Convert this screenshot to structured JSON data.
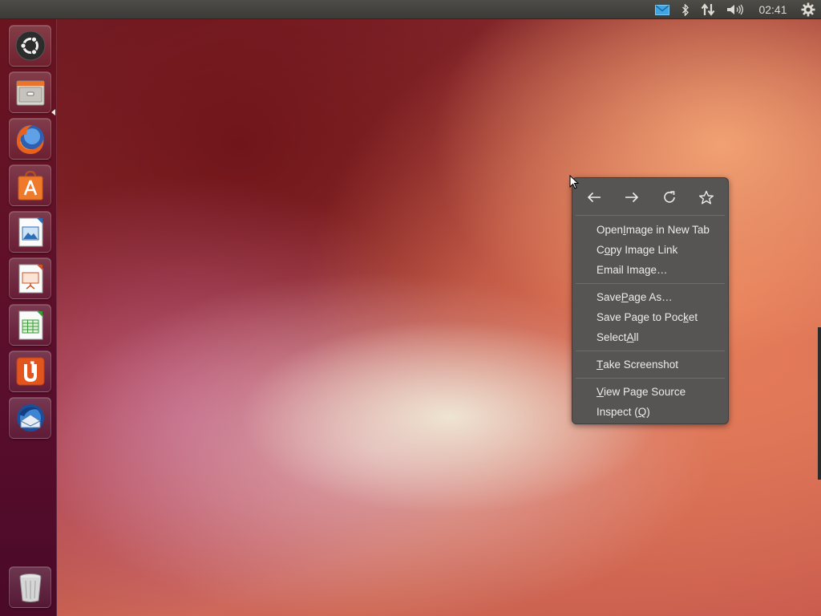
{
  "top_panel": {
    "clock": "02:41",
    "indicators": [
      "mail-icon",
      "bluetooth-icon",
      "network-icon",
      "volume-icon",
      "gear-icon"
    ],
    "mail_color": "#3ea6e6"
  },
  "launcher": {
    "items": [
      {
        "name": "ubuntu-dash",
        "icon": "ubuntu-logo-icon"
      },
      {
        "name": "files",
        "icon": "file-cabinet-icon"
      },
      {
        "name": "firefox",
        "icon": "firefox-icon"
      },
      {
        "name": "software-center",
        "icon": "shopping-bag-icon"
      },
      {
        "name": "libreoffice-draw",
        "icon": "document-draw-icon"
      },
      {
        "name": "libreoffice-impress",
        "icon": "presentation-icon"
      },
      {
        "name": "libreoffice-calc",
        "icon": "spreadsheet-icon"
      },
      {
        "name": "ubuntu-one",
        "icon": "ubuntu-one-icon"
      },
      {
        "name": "thunderbird",
        "icon": "thunderbird-icon"
      },
      {
        "name": "trash",
        "icon": "trash-icon"
      }
    ]
  },
  "context_menu": {
    "nav_icons": [
      "back-arrow-icon",
      "forward-arrow-icon",
      "reload-icon",
      "bookmark-star-icon"
    ],
    "items": [
      {
        "pre": "Open ",
        "mn": "I",
        "post": "mage in New Tab"
      },
      {
        "pre": "C",
        "mn": "o",
        "post": "py Image Link"
      },
      {
        "pre": "Email Ima",
        "mn": "g",
        "post": "e…"
      },
      {
        "pre": "Save ",
        "mn": "P",
        "post": "age As…"
      },
      {
        "pre": "Save Page to Poc",
        "mn": "k",
        "post": "et"
      },
      {
        "pre": "Select ",
        "mn": "A",
        "post": "ll"
      },
      {
        "pre": "",
        "mn": "T",
        "post": "ake Screenshot"
      },
      {
        "pre": "",
        "mn": "V",
        "post": "iew Page Source"
      },
      {
        "pre": "Inspect (",
        "mn": "Q",
        "post": ")"
      }
    ]
  }
}
